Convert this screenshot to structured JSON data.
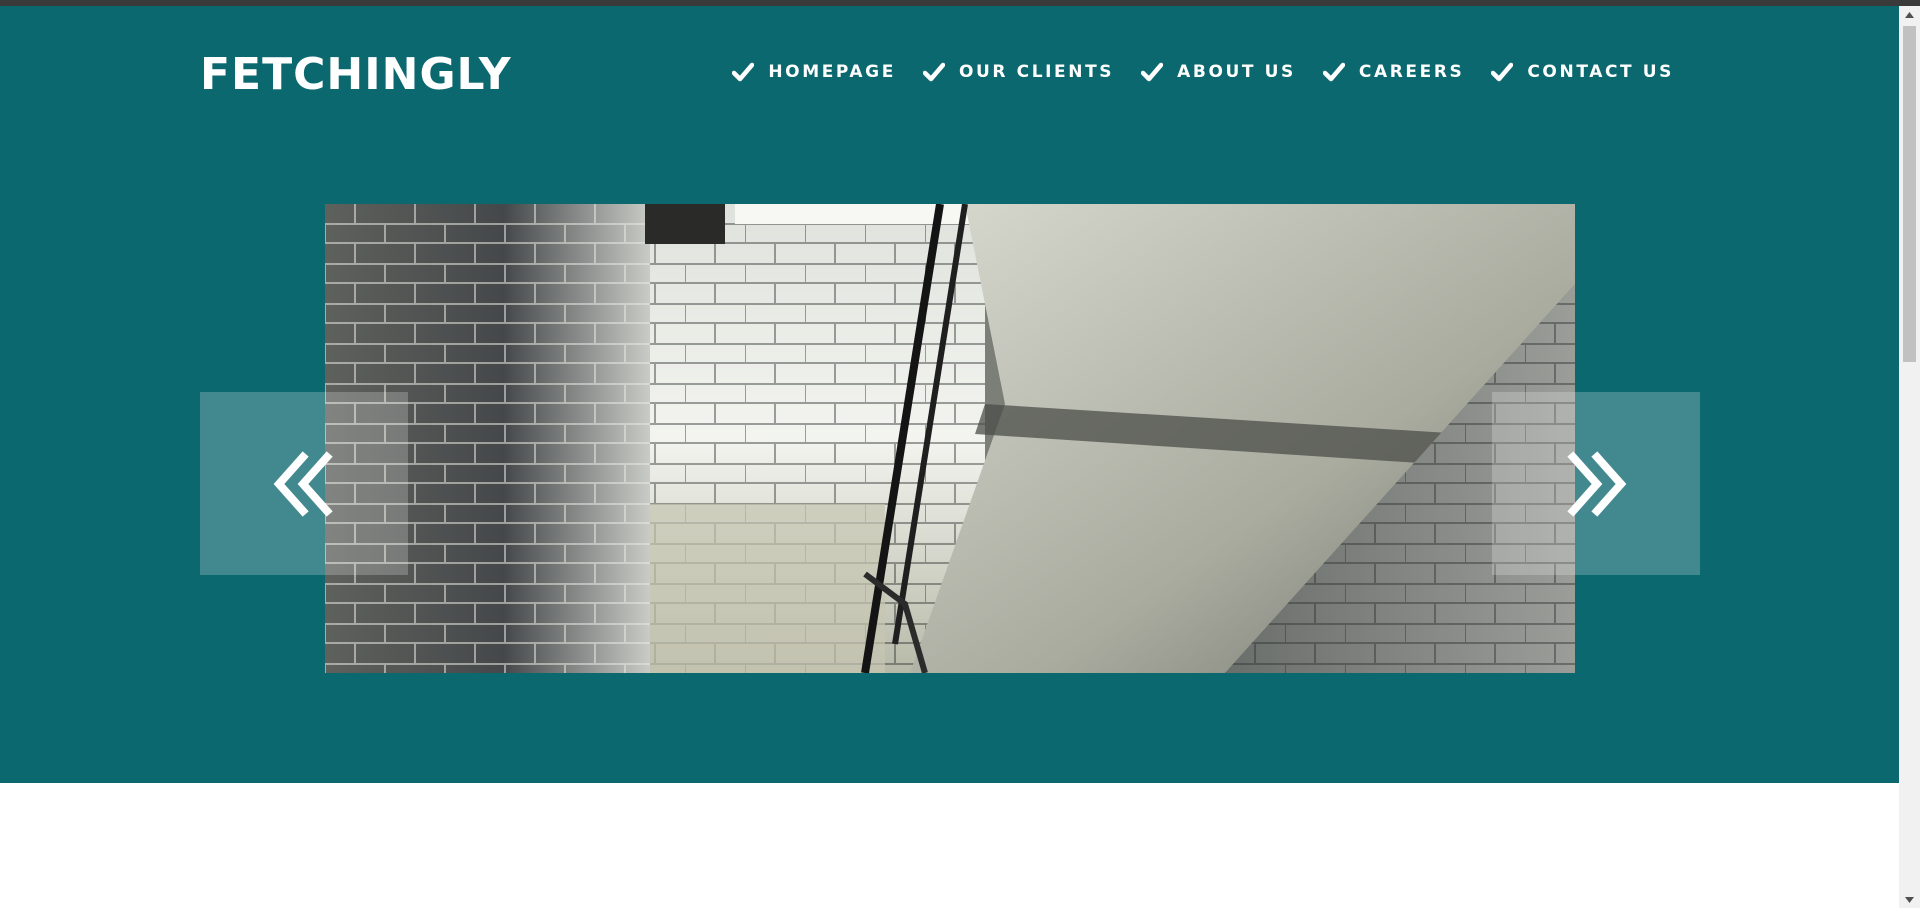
{
  "site": {
    "logo": "FETCHINGLY"
  },
  "nav": {
    "items": [
      {
        "label": "HOMEPAGE",
        "icon": "check-icon"
      },
      {
        "label": "OUR CLIENTS",
        "icon": "check-icon"
      },
      {
        "label": "ABOUT US",
        "icon": "check-icon"
      },
      {
        "label": "CAREERS",
        "icon": "check-icon"
      },
      {
        "label": "CONTACT US",
        "icon": "check-icon"
      }
    ]
  },
  "slider": {
    "image": "stairwell-photo",
    "prev_icon": "double-chevron-left-icon",
    "next_icon": "double-chevron-right-icon"
  },
  "colors": {
    "hero_background": "#0c686f",
    "text": "#ffffff",
    "arrow_box": "rgba(255,255,255,0.22)",
    "scrollbar_track": "#f1f1f1",
    "scrollbar_thumb": "#c1c1c1"
  }
}
